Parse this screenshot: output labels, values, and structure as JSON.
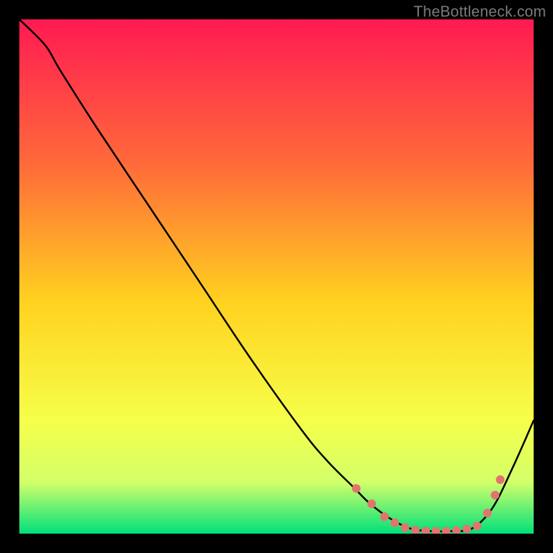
{
  "watermark": "TheBottleneck.com",
  "colors": {
    "bg_black": "#000000",
    "watermark": "#7a7a7a",
    "gradient_top": "#ff1a52",
    "gradient_mid1": "#ff6a3a",
    "gradient_mid2": "#ffd21f",
    "gradient_mid3": "#f6ff4a",
    "gradient_mid4": "#d3ff6a",
    "gradient_bottom": "#00e07a",
    "curve": "#000000",
    "dot": "#e2746e"
  },
  "chart_data": {
    "type": "line",
    "title": "",
    "xlabel": "",
    "ylabel": "",
    "xlim": [
      0,
      100
    ],
    "ylim": [
      0,
      100
    ],
    "grid": false,
    "legend": false,
    "note": "Bottleneck-style curve. x is relative hardware balance (0–100), y is bottleneck severity (0 = none, 100 = max). Curve reaches near-zero around x≈76–90, rises toward both ends.",
    "series": [
      {
        "name": "bottleneck_curve",
        "x": [
          0,
          5,
          8,
          15,
          25,
          35,
          45,
          55,
          60,
          65,
          68,
          72,
          76,
          80,
          84,
          88,
          92,
          96,
          100
        ],
        "y": [
          100,
          95,
          90,
          79,
          64,
          49,
          34,
          20,
          14,
          9,
          6,
          3,
          1,
          0.5,
          0.5,
          1,
          5,
          13,
          22
        ]
      }
    ],
    "markers": {
      "name": "highlight_dots",
      "x": [
        65.5,
        68.5,
        71,
        73,
        75,
        77,
        79,
        81,
        83,
        85,
        87,
        89,
        91,
        92.5,
        93.5
      ],
      "y": [
        8.8,
        5.8,
        3.3,
        2.1,
        1.2,
        0.7,
        0.5,
        0.5,
        0.5,
        0.6,
        0.9,
        1.5,
        4.0,
        7.5,
        10.5
      ]
    }
  }
}
